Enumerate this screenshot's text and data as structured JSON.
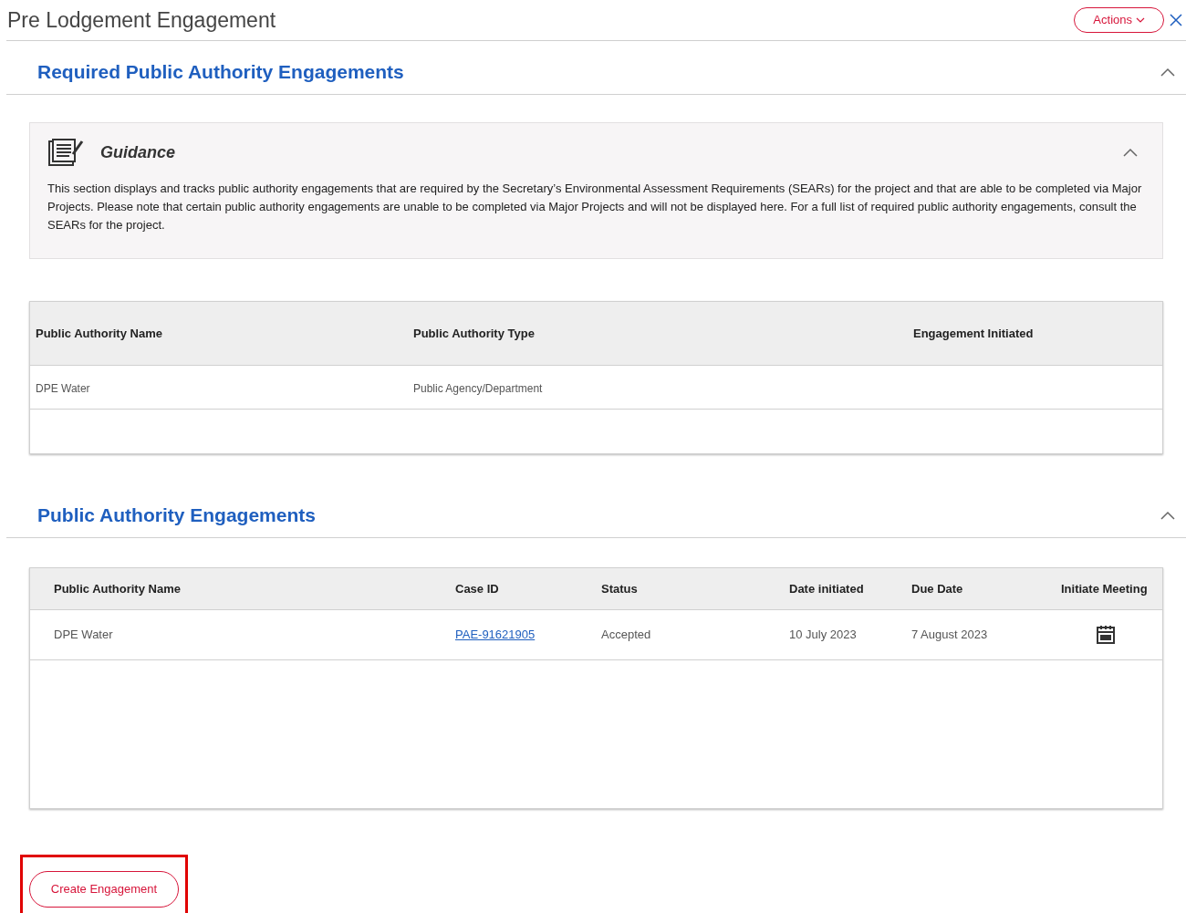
{
  "header": {
    "title": "Pre Lodgement Engagement",
    "actions_button": "Actions"
  },
  "required_section": {
    "title": "Required Public Authority Engagements",
    "expanded": true,
    "guidance": {
      "title": "Guidance",
      "expanded": true,
      "text": "This section displays and tracks public authority engagements that are required by the Secretary’s Environmental Assessment Requirements (SEARs) for the project and that are able to be completed via Major Projects. Please note that certain public authority engagements are unable to be completed via Major Projects and will not be displayed here. For a full list of required public authority engagements, consult the SEARs for the project."
    },
    "table": {
      "columns": [
        "Public Authority Name",
        "Public Authority Type",
        "Engagement Initiated"
      ],
      "rows": [
        [
          "DPE Water",
          "Public Agency/Department",
          ""
        ]
      ]
    }
  },
  "engagements_section": {
    "title": "Public Authority Engagements",
    "expanded": true,
    "table": {
      "columns": [
        "Public Authority Name",
        "Case ID",
        "Status",
        "Date initiated",
        "Due Date",
        "Initiate Meeting"
      ],
      "rows": [
        {
          "name": "DPE Water",
          "case_id": "PAE-91621905",
          "status": "Accepted",
          "date_initiated": "10 July 2023",
          "due_date": "7 August 2023"
        }
      ]
    }
  },
  "create_button": "Create Engagement"
}
